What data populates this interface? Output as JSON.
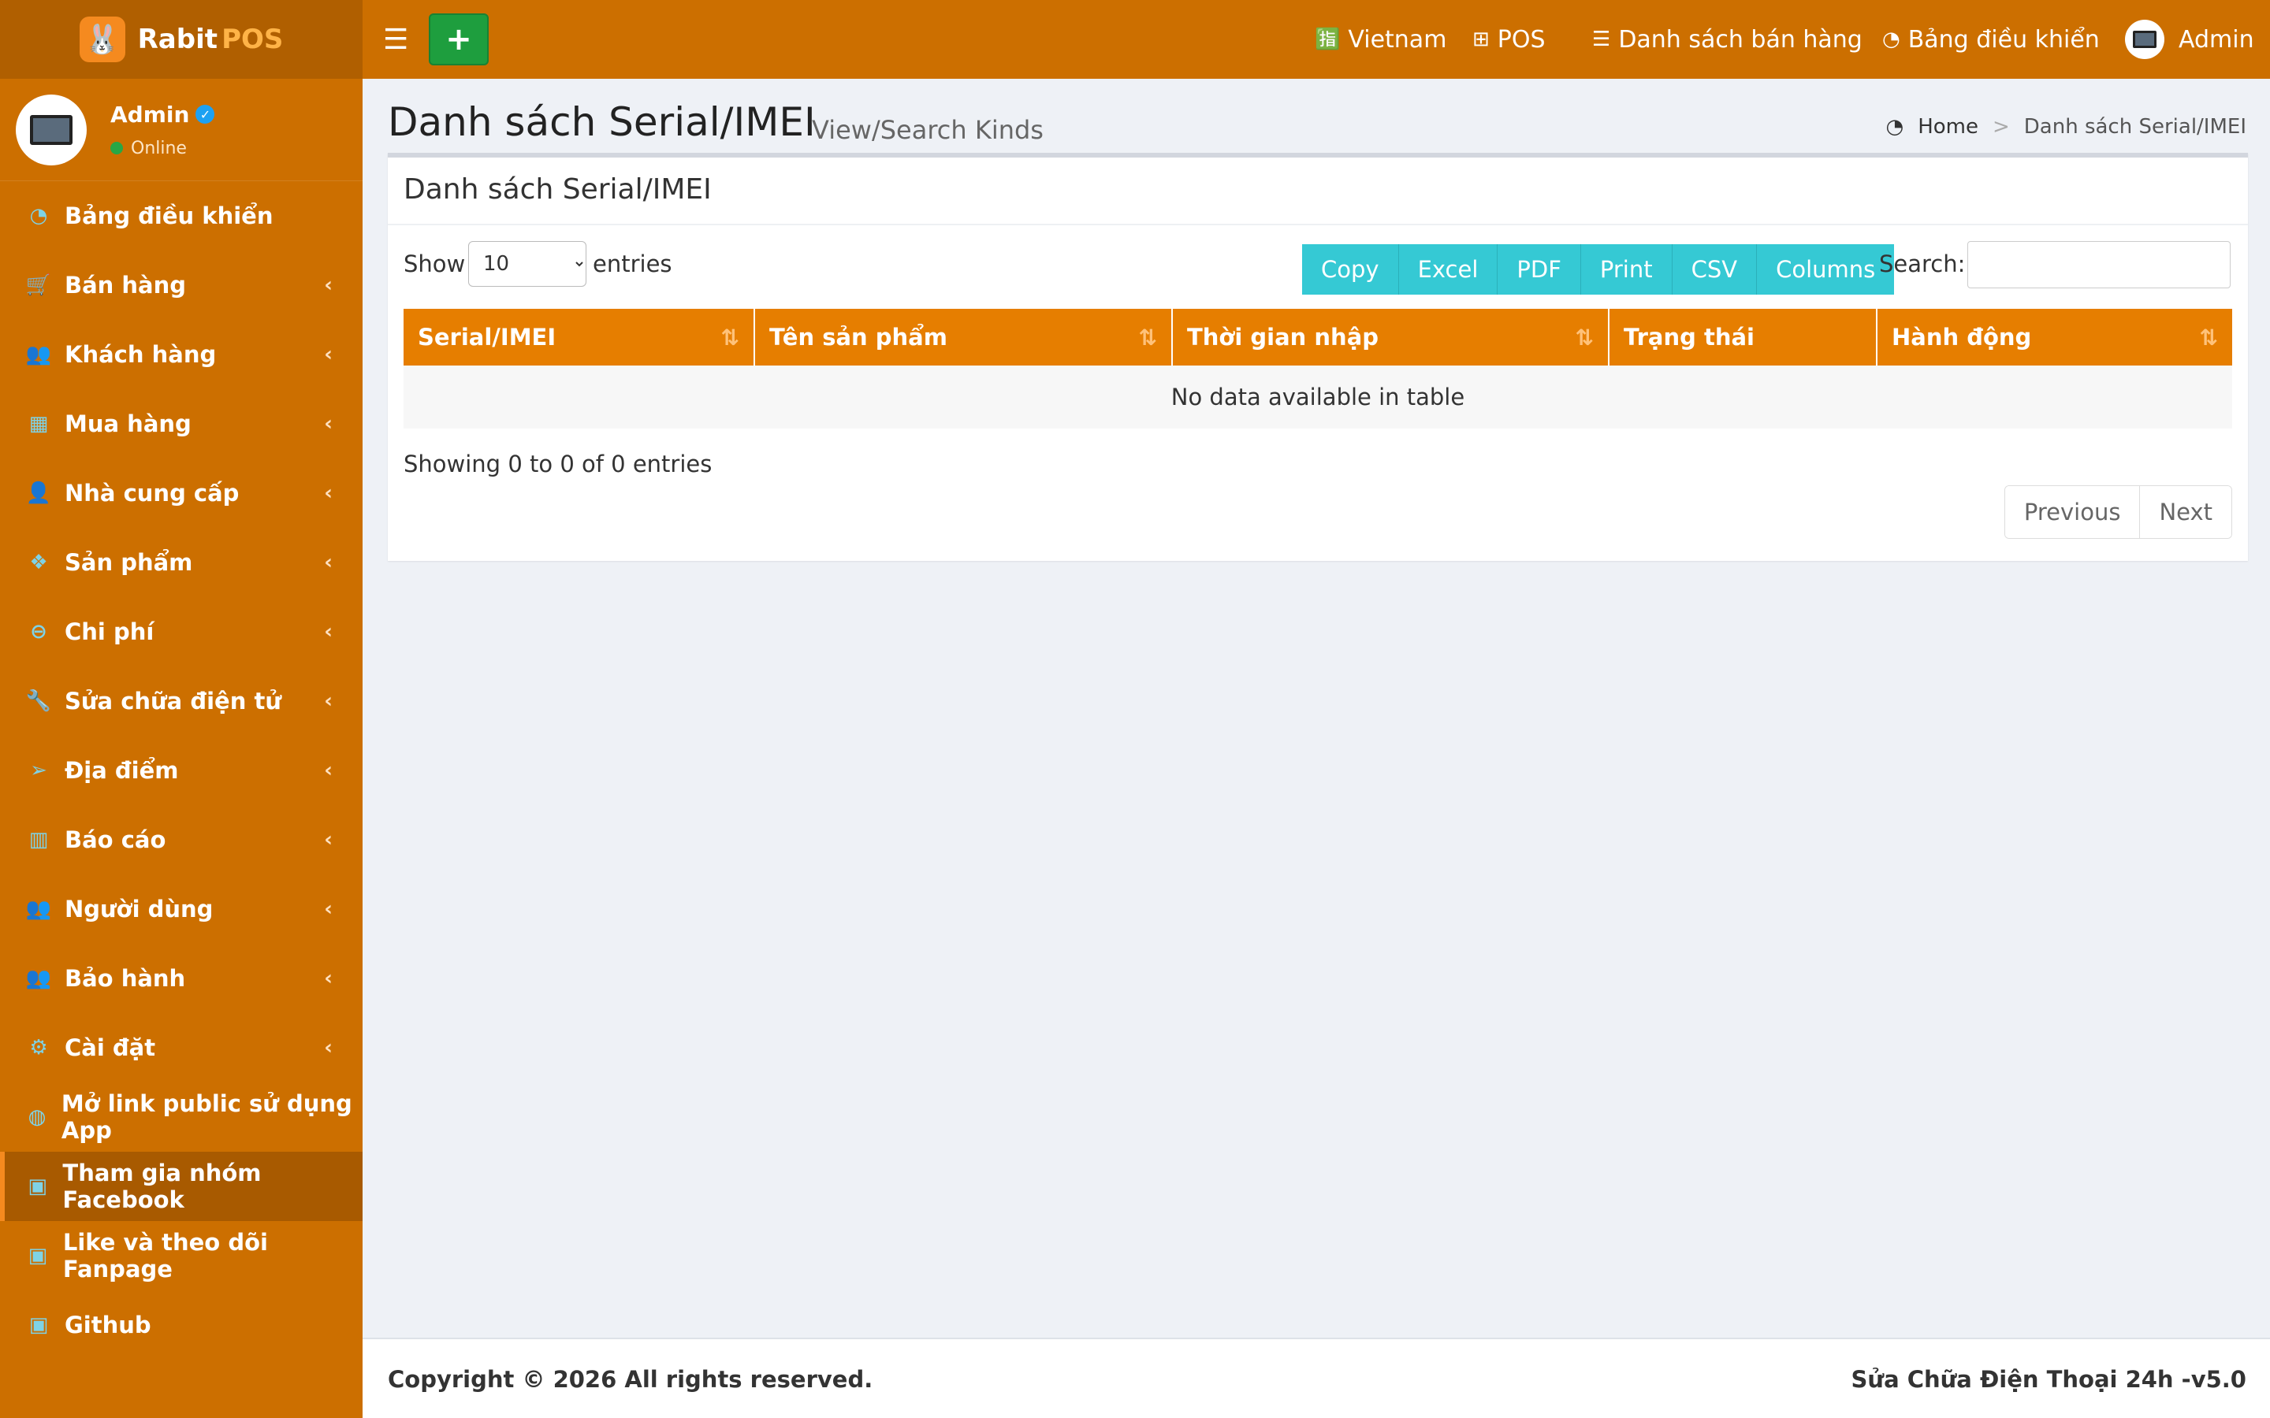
{
  "brand": {
    "name_part1": "Rabit",
    "name_part2": "POS",
    "logo_icon": "rabbit-icon"
  },
  "user": {
    "name": "Admin",
    "status": "Online"
  },
  "sidebar": {
    "items": [
      {
        "label": "Bảng điều khiển",
        "icon": "dashboard-icon",
        "has_submenu": false
      },
      {
        "label": "Bán hàng",
        "icon": "cart-icon",
        "has_submenu": true
      },
      {
        "label": "Khách hàng",
        "icon": "users-icon",
        "has_submenu": true
      },
      {
        "label": "Mua hàng",
        "icon": "grid-icon",
        "has_submenu": true
      },
      {
        "label": "Nhà cung cấp",
        "icon": "user-plus-icon",
        "has_submenu": true
      },
      {
        "label": "Sản phẩm",
        "icon": "cubes-icon",
        "has_submenu": true
      },
      {
        "label": "Chi phí",
        "icon": "minus-circle-icon",
        "has_submenu": true
      },
      {
        "label": "Sửa chữa điện tử",
        "icon": "wrench-icon",
        "has_submenu": true
      },
      {
        "label": "Địa điểm",
        "icon": "paper-plane-icon",
        "has_submenu": true
      },
      {
        "label": "Báo cáo",
        "icon": "bar-chart-icon",
        "has_submenu": true
      },
      {
        "label": "Người dùng",
        "icon": "users-icon",
        "has_submenu": true
      },
      {
        "label": "Bảo hành",
        "icon": "users-icon",
        "has_submenu": true
      },
      {
        "label": "Cài đặt",
        "icon": "gears-icon",
        "has_submenu": true
      },
      {
        "label": "Mở link public sử dụng App",
        "icon": "globe-icon",
        "has_submenu": false
      },
      {
        "label": "Tham gia nhóm Facebook",
        "icon": "briefcase-icon",
        "has_submenu": false,
        "active": true
      },
      {
        "label": "Like và theo dõi Fanpage",
        "icon": "briefcase-icon",
        "has_submenu": false
      },
      {
        "label": "Github",
        "icon": "briefcase-icon",
        "has_submenu": false
      }
    ]
  },
  "topbar": {
    "add_label": "+",
    "language": "Vietnam",
    "pos": "POS",
    "sales_list": "Danh sách bán hàng",
    "dashboard": "Bảng điều khiển",
    "user": "Admin"
  },
  "page": {
    "title": "Danh sách Serial/IMEI",
    "subtitle": "View/Search Kinds",
    "breadcrumb": {
      "home": "Home",
      "separator": ">",
      "current": "Danh sách Serial/IMEI"
    }
  },
  "box": {
    "title": "Danh sách Serial/IMEI"
  },
  "table_controls": {
    "show_label": "Show",
    "entries_label": "entries",
    "page_length": "10",
    "export_buttons": [
      "Copy",
      "Excel",
      "PDF",
      "Print",
      "CSV",
      "Columns"
    ],
    "search_label": "Search:",
    "search_value": ""
  },
  "table": {
    "columns": [
      {
        "label": "Serial/IMEI",
        "sortable": true
      },
      {
        "label": "Tên sản phẩm",
        "sortable": true
      },
      {
        "label": "Thời gian nhập",
        "sortable": true
      },
      {
        "label": "Trạng thái",
        "sortable": false
      },
      {
        "label": "Hành động",
        "sortable": true
      }
    ],
    "empty_message": "No data available in table"
  },
  "pagination": {
    "info": "Showing 0 to 0 of 0 entries",
    "previous": "Previous",
    "next": "Next"
  },
  "footer": {
    "copyright": "Copyright © 2026 All rights reserved.",
    "version": "Sửa Chữa Điện Thoại 24h -v5.0"
  },
  "colors": {
    "sidebar": "#cc6f00",
    "topbar": "#cc6f00",
    "table_header": "#e67e00",
    "export_buttons": "#35c9d4",
    "add_button": "#1e9e3e",
    "icon_accent": "#7fd3e6"
  }
}
